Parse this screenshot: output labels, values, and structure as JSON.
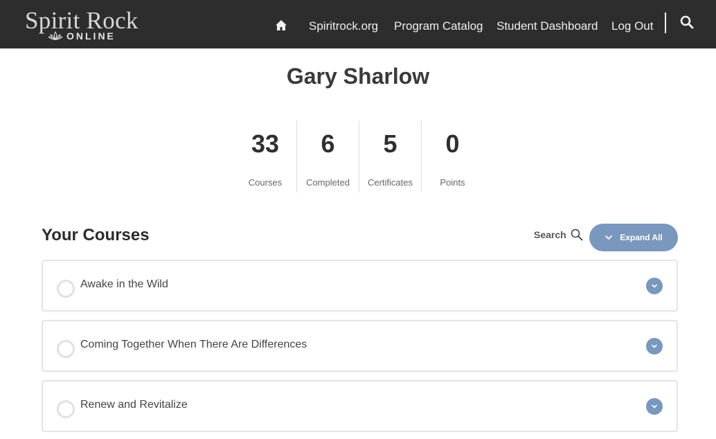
{
  "header": {
    "logo_main": "Spirit Rock",
    "logo_sub": "ONLINE",
    "nav": [
      {
        "label": "Spiritrock.org"
      },
      {
        "label": "Program Catalog"
      },
      {
        "label": "Student Dashboard"
      },
      {
        "label": "Log Out"
      }
    ],
    "icons": {
      "home": "home-icon",
      "search": "search-icon",
      "logo_mark": "lotus-icon"
    }
  },
  "profile": {
    "name": "Gary Sharlow",
    "stats": [
      {
        "value": "33",
        "label": "Courses"
      },
      {
        "value": "6",
        "label": "Completed"
      },
      {
        "value": "5",
        "label": "Certificates"
      },
      {
        "value": "0",
        "label": "Points"
      }
    ]
  },
  "courses": {
    "heading": "Your Courses",
    "search_label": "Search",
    "expand_label": "Expand All",
    "items": [
      {
        "title": "Awake in the Wild"
      },
      {
        "title": "Coming Together When There Are Differences"
      },
      {
        "title": "Renew and Revitalize"
      }
    ]
  },
  "colors": {
    "header_bg": "#2d2d2d",
    "accent": "#7a97bd",
    "border": "#e4e4e4"
  }
}
